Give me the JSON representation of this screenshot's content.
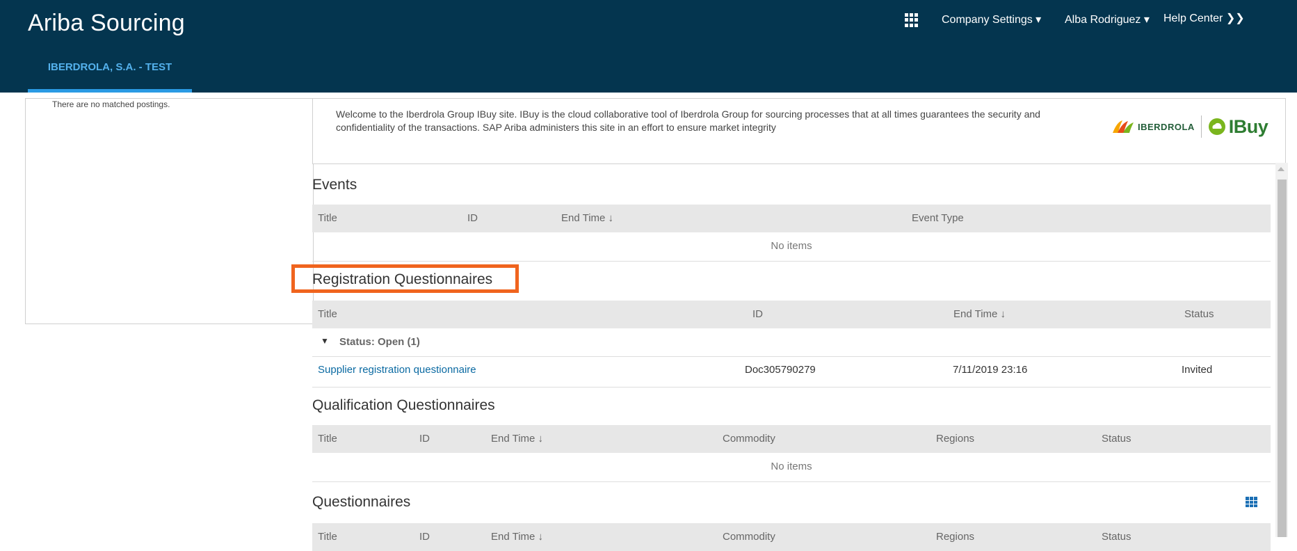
{
  "header": {
    "app_title": "Ariba Sourcing",
    "company_tab": "IBERDROLA, S.A. - TEST",
    "nav": {
      "company_settings": "Company Settings ▾",
      "user": "Alba Rodriguez ▾",
      "help_center": "Help Center ❯❯"
    }
  },
  "sidebar": {
    "message": "There are no matched postings."
  },
  "welcome": {
    "text": "Welcome to the Iberdrola Group IBuy site. IBuy is the cloud collaborative tool of Iberdrola Group for sourcing processes that at all times guarantees the security and confidentiality of the transactions. SAP Ariba administers this site in an effort to ensure market integrity",
    "logo_iberdrola": "IBERDROLA",
    "logo_ibuy": "IBuy"
  },
  "events": {
    "title": "Events",
    "columns": [
      "Title",
      "ID",
      "End Time ↓",
      "Event Type"
    ],
    "empty": "No items"
  },
  "registration": {
    "title": "Registration Questionnaires",
    "columns": [
      "Title",
      "ID",
      "End Time ↓",
      "Status"
    ],
    "group_label": "Status: Open  (1)",
    "rows": [
      {
        "title": "Supplier registration questionnaire",
        "id": "Doc305790279",
        "end_time": "7/11/2019 23:16",
        "status": "Invited"
      }
    ]
  },
  "qualification": {
    "title": "Qualification Questionnaires",
    "columns": [
      "Title",
      "ID",
      "End Time ↓",
      "Commodity",
      "Regions",
      "Status"
    ],
    "empty": "No items"
  },
  "questionnaires": {
    "title": "Questionnaires",
    "columns": [
      "Title",
      "ID",
      "End Time ↓",
      "Commodity",
      "Regions",
      "Status"
    ]
  },
  "colors": {
    "header_bg": "#04354f",
    "tab_accent": "#2a9ae3",
    "highlight": "#f0641e",
    "link": "#0b6aa2"
  }
}
